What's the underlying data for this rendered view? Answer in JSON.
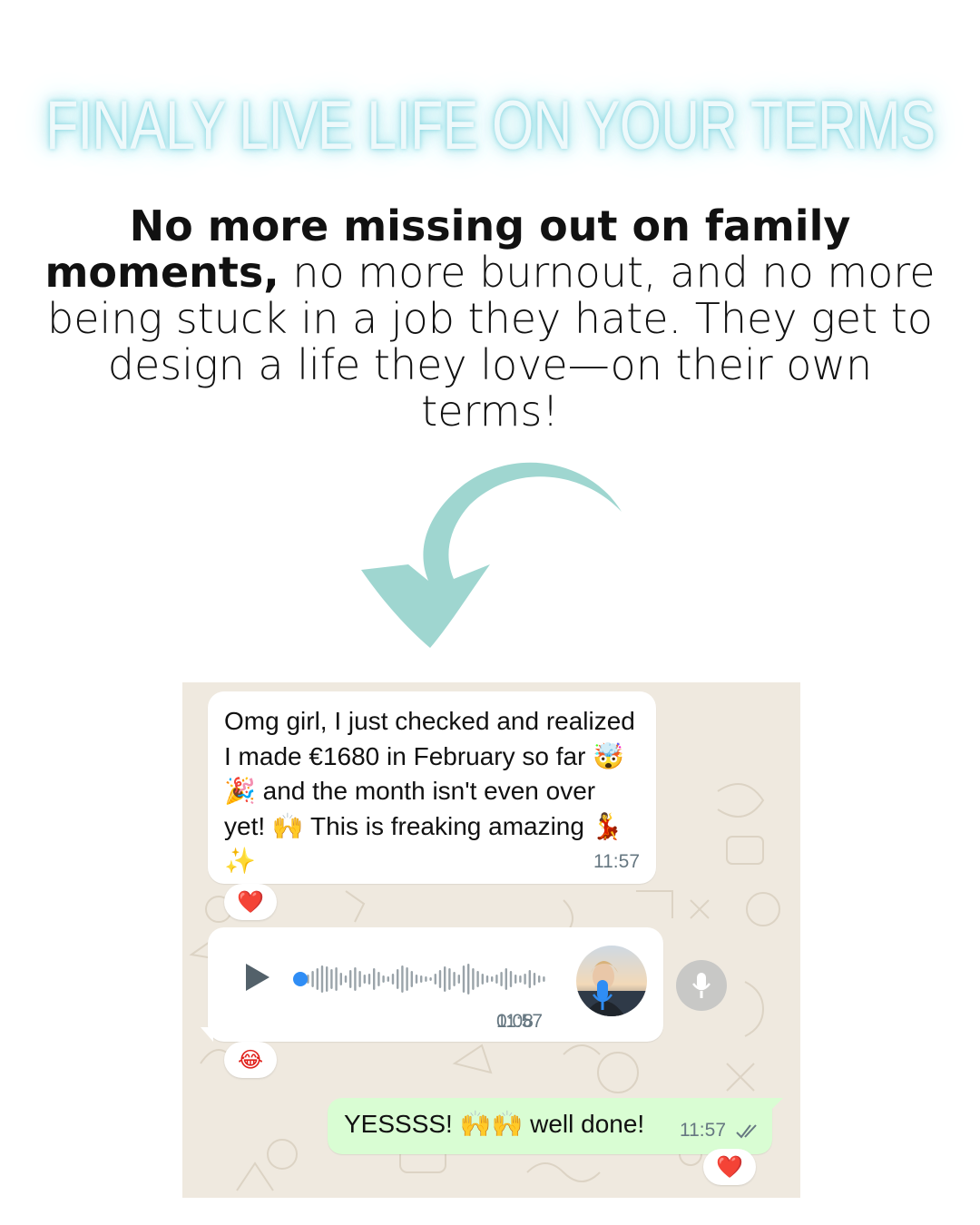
{
  "headline": "FINALY LIVE LIFE ON YOUR TERMS",
  "subcopy": {
    "bold_part": "No more missing out on family moments,",
    "regular_part": " no more burnout, and no more being stuck in a job they hate. They get to design a life they love—on their own terms!"
  },
  "colors": {
    "arrow": "#9fd6d0",
    "headline_glow": "#7fd3de",
    "chat_bg": "#efe9df",
    "sent_bubble": "#d9fdd3",
    "voice_progress": "#2f8df5"
  },
  "chat": {
    "message1": {
      "text": "Omg girl, I just checked and realized I made €1680 in February so far 🤯🎉 and the month isn't even over yet! 🙌 This is freaking amazing 💃✨",
      "time": "11:57",
      "reaction": "❤️"
    },
    "voice_note": {
      "duration": "0:08",
      "time": "11:57",
      "reaction": "😂",
      "progress": 0
    },
    "sent_message": {
      "text": "YESSSS! 🙌🙌 well done!",
      "time": "11:57",
      "reaction": "❤️"
    }
  }
}
